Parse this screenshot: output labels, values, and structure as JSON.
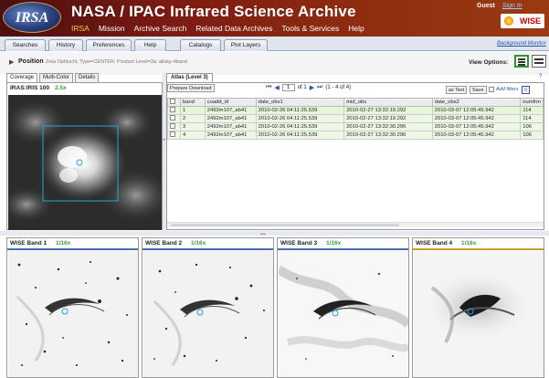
{
  "header": {
    "logo_text": "IRSA",
    "title": "NASA / IPAC Infrared Science Archive",
    "nav": [
      "IRSA",
      "Mission",
      "Archive Search",
      "Related Data Archives",
      "Tools & Services",
      "Help"
    ],
    "guest": "Guest",
    "sign_in": "Sign In",
    "wise_logo": "WISE"
  },
  "tabs": [
    "Searches",
    "History",
    "Preferences",
    "Help",
    "Catalogs",
    "Plot Layers"
  ],
  "background_monitor": "Background Monitor",
  "position": {
    "label": "Position",
    "description": "Zeta Ophiuchi; Type=CENTER; Product Level=3a; allsky-4band"
  },
  "view_options_label": "View Options:",
  "coverage": {
    "tabs": [
      "Coverage",
      "Multi-Color",
      "Details"
    ],
    "title": "IRAS:IRIS 100",
    "zoom": "2.5x"
  },
  "table": {
    "tab": "Atlas (Level 3)",
    "prepare_download": "Prepare Download",
    "page": "1",
    "of_label": "of 1",
    "count": "(1 - 4 of 4)",
    "as_text": "as Text",
    "save": "Save",
    "add_filters": "Add filters",
    "help": "?",
    "columns": [
      "band",
      "coadd_id",
      "date_obs1",
      "mid_obs",
      "date_obs2",
      "numfrm"
    ],
    "rows": [
      [
        "1",
        "2492m107_ab41",
        "2010-02-26 04:11:25.539",
        "2010-02-27 13:32:19.292",
        "2010-03-07 12:05:45.942",
        "114"
      ],
      [
        "2",
        "2492m107_ab41",
        "2010-02-26 04:11:25.539",
        "2010-02-27 13:32:19.292",
        "2010-03-07 12:05:45.942",
        "114"
      ],
      [
        "3",
        "2492m107_ab41",
        "2010-02-26 04:11:25.539",
        "2010-02-27 13:32:30.296",
        "2010-03-07 12:05:45.942",
        "106"
      ],
      [
        "4",
        "2492m107_ab41",
        "2010-02-26 04:11:25.539",
        "2010-02-27 13:32:30.296",
        "2010-03-07 12:05:45.942",
        "106"
      ]
    ]
  },
  "bands": [
    {
      "title": "WISE Band 1",
      "zoom": "1/16x"
    },
    {
      "title": "WISE Band 2",
      "zoom": "1/16x"
    },
    {
      "title": "WISE Band 3",
      "zoom": "1/16x"
    },
    {
      "title": "WISE Band 4",
      "zoom": "1/16x"
    }
  ],
  "colors": {
    "accent": "#3a9a3a",
    "link": "#2a55a8",
    "overlay": "#2aa0e0"
  }
}
